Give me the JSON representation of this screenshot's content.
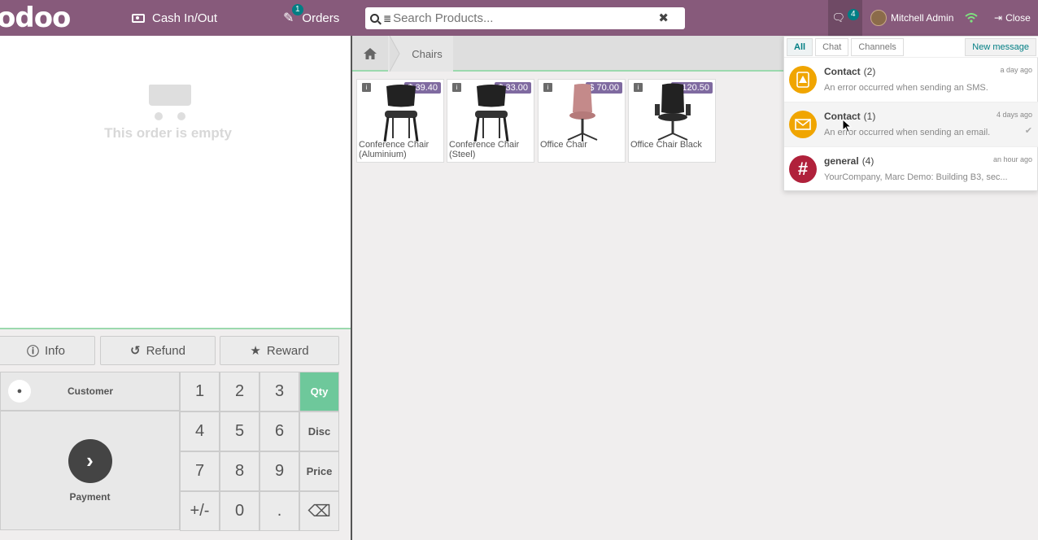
{
  "topbar": {
    "logo": "odoo",
    "cash_label": "Cash In/Out",
    "orders_label": "Orders",
    "orders_badge": "1",
    "search_placeholder": "Search Products...",
    "chat_count": "4",
    "user_name": "Mitchell Admin",
    "close_label": "Close"
  },
  "order": {
    "empty_text": "This order is empty"
  },
  "controls": {
    "info": "Info",
    "refund": "Refund",
    "reward": "Reward"
  },
  "numpad": {
    "customer": "Customer",
    "payment": "Payment",
    "keys": [
      "1",
      "2",
      "3",
      "4",
      "5",
      "6",
      "7",
      "8",
      "9",
      "+/-",
      "0",
      "."
    ],
    "modes": [
      "Qty",
      "Disc",
      "Price"
    ],
    "backspace": "⌫",
    "active_mode": "Qty"
  },
  "breadcrumb": {
    "category": "Chairs"
  },
  "products": [
    {
      "name": "Conference Chair (Aluminium)",
      "price": "$ 39.40"
    },
    {
      "name": "Conference Chair (Steel)",
      "price": "$ 33.00"
    },
    {
      "name": "Office Chair",
      "price": "$ 70.00"
    },
    {
      "name": "Office Chair Black",
      "price": "$ 120.50"
    }
  ],
  "messaging": {
    "tabs": [
      "All",
      "Chat",
      "Channels"
    ],
    "active_tab": "All",
    "new_message": "New message",
    "items": [
      {
        "title": "Contact",
        "count": "(2)",
        "time": "a day ago",
        "body": "An error occurred when sending an SMS.",
        "color": "#f0a500"
      },
      {
        "title": "Contact",
        "count": "(1)",
        "time": "4 days ago",
        "body": "An error occurred when sending an email.",
        "color": "#f0a500"
      },
      {
        "title": "general",
        "count": "(4)",
        "time": "an hour ago",
        "body": "YourCompany, Marc Demo: Building B3, sec...",
        "color": "#b0213b"
      }
    ]
  },
  "colors": {
    "brand": "#875a7b",
    "accent": "#017e84",
    "active_mode": "#6ec89b",
    "price_badge": "#7f6aa0"
  }
}
